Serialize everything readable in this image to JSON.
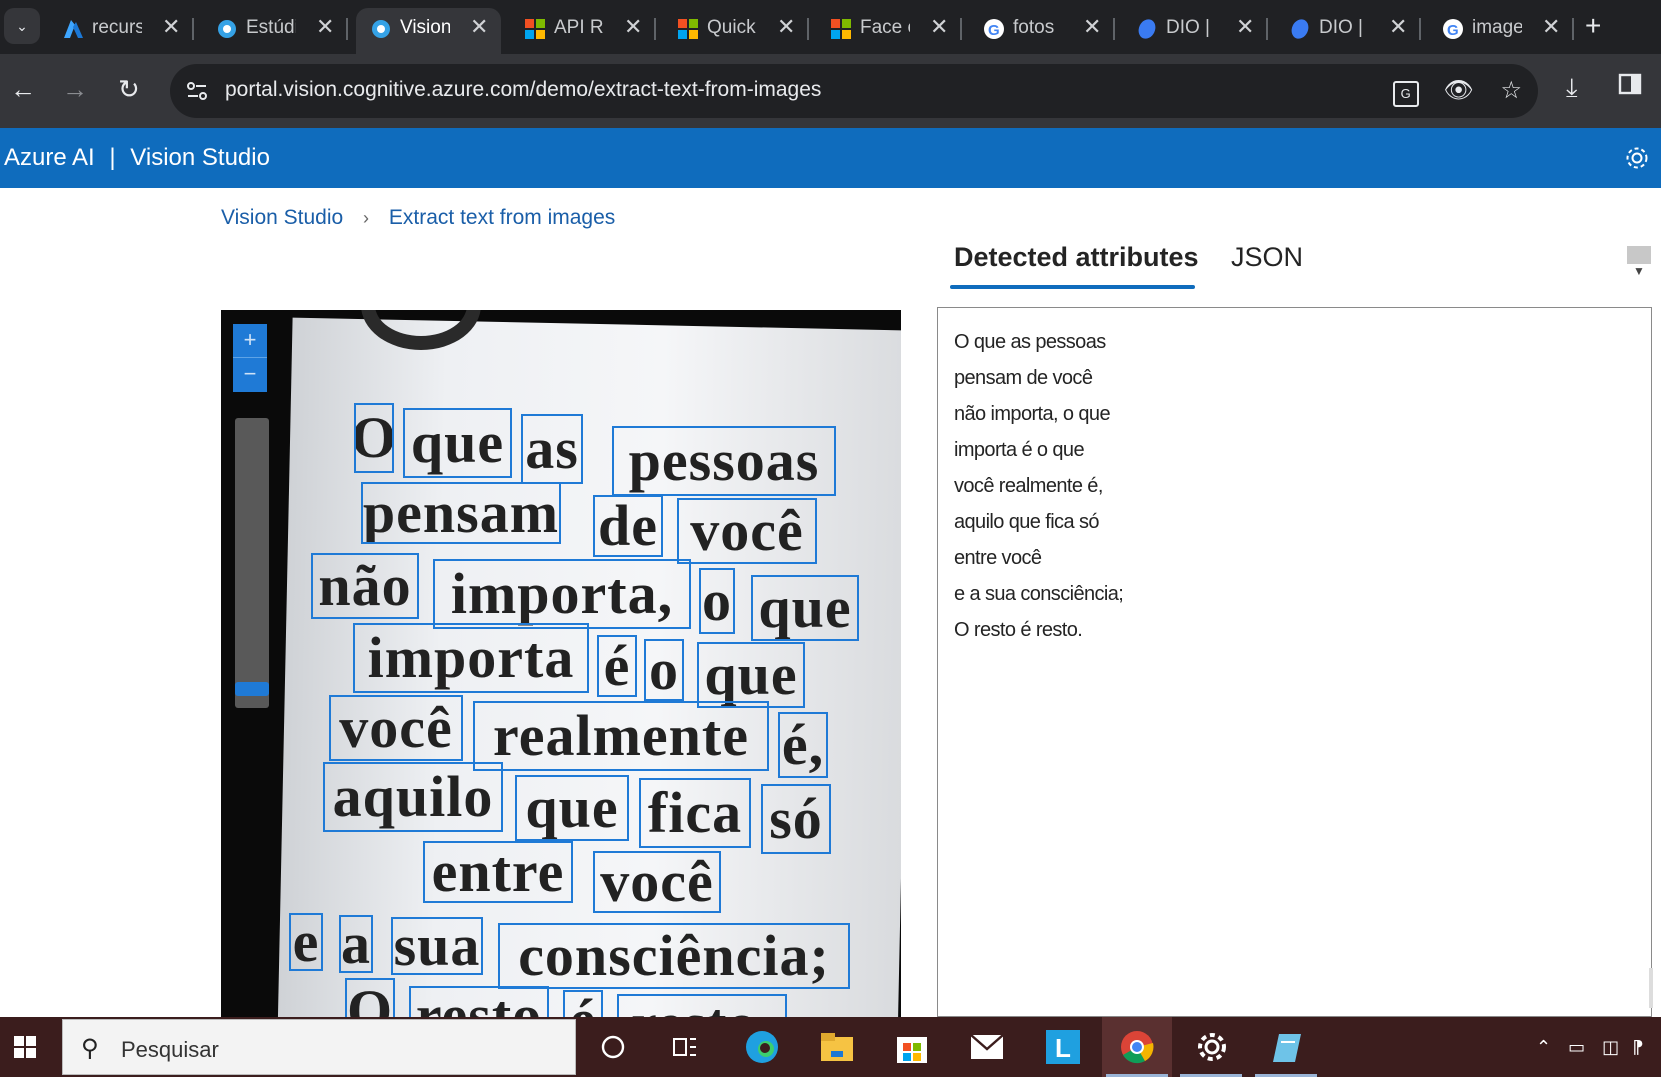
{
  "browser": {
    "tabs": [
      {
        "label": "recurs",
        "icon": "azure-icon",
        "active": false
      },
      {
        "label": "Estúdi",
        "icon": "vision-studio-icon",
        "active": false
      },
      {
        "label": "Vision",
        "icon": "vision-studio-icon",
        "active": true
      },
      {
        "label": "API Re",
        "icon": "microsoft-icon",
        "active": false
      },
      {
        "label": "Quick",
        "icon": "microsoft-icon",
        "active": false
      },
      {
        "label": "Face c",
        "icon": "microsoft-icon",
        "active": false
      },
      {
        "label": "fotos",
        "icon": "google-icon",
        "active": false
      },
      {
        "label": "DIO |",
        "icon": "dio-icon",
        "active": false
      },
      {
        "label": "DIO |",
        "icon": "dio-icon",
        "active": false
      },
      {
        "label": "image",
        "icon": "google-icon",
        "active": false
      }
    ],
    "url": "portal.vision.cognitive.azure.com/demo/extract-text-from-images"
  },
  "app": {
    "brand": "Azure AI",
    "separator": "|",
    "product": "Vision Studio",
    "accent": "#0f6cbd"
  },
  "breadcrumb": {
    "root": "Vision Studio",
    "current": "Extract text from images"
  },
  "image_words": [
    "O",
    "que",
    "as",
    "pessoas",
    "pensam",
    "de",
    "você",
    "não",
    "importa,",
    "o",
    "que",
    "importa",
    "é",
    "o",
    "que",
    "você",
    "realmente",
    "é,",
    "aquilo",
    "que",
    "fica",
    "só",
    "entre",
    "você",
    "e",
    "a",
    "sua",
    "consciência;",
    "O",
    "resto",
    "é",
    "resto."
  ],
  "zoom": {
    "plus": "+",
    "minus": "−",
    "level": 0.9
  },
  "results": {
    "tabs": [
      "Detected attributes",
      "JSON"
    ],
    "active_tab": "Detected attributes",
    "lines": [
      "O que as pessoas",
      "pensam de você",
      "não importa, o que",
      "importa é o que",
      "você realmente é,",
      "aquilo que fica só",
      "entre você",
      "e a sua consciência;",
      "O resto é resto."
    ]
  },
  "taskbar": {
    "search_placeholder": "Pesquisar"
  }
}
